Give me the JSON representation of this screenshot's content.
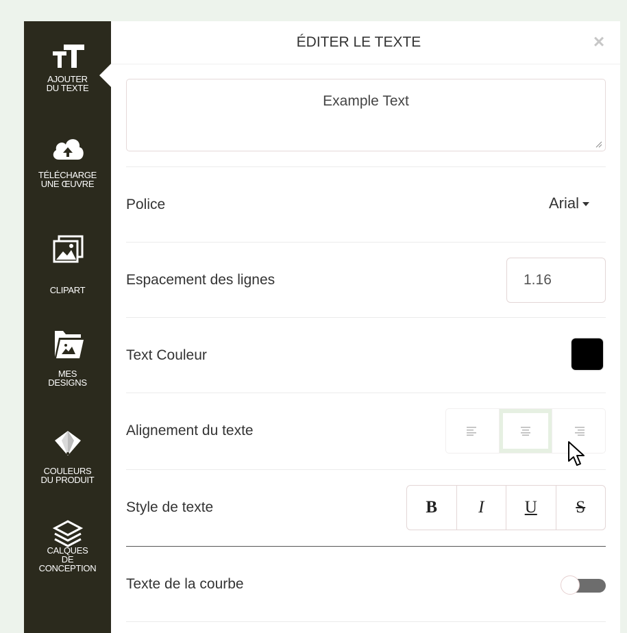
{
  "sidebar": {
    "items": [
      {
        "label": "AJOUTER\nDU TEXTE",
        "icon": "text-size-icon"
      },
      {
        "label": "TÉLÉCHARGE\nUNE ŒUVRE",
        "icon": "cloud-upload-icon"
      },
      {
        "label": "CLIPART",
        "icon": "image-stack-icon"
      },
      {
        "label": "MES\nDESIGNS",
        "icon": "folder-image-icon"
      },
      {
        "label": "COULEURS\nDU PRODUIT",
        "icon": "color-swatches-icon"
      },
      {
        "label": "CALQUES\nDE\nCONCEPTION",
        "icon": "layers-icon"
      }
    ]
  },
  "panel": {
    "title": "ÉDITER LE TEXTE",
    "close_icon": "×",
    "text_value": "Example Text",
    "font": {
      "label": "Police",
      "value": "Arial"
    },
    "line_spacing": {
      "label": "Espacement des lignes",
      "value": "1.16"
    },
    "text_color": {
      "label": "Text Couleur",
      "value": "#000000"
    },
    "alignment": {
      "label": "Alignement du texte",
      "options": [
        "left",
        "center",
        "right"
      ],
      "selected": "center"
    },
    "text_style": {
      "label": "Style de texte",
      "buttons": [
        "B",
        "I",
        "U",
        "S"
      ]
    },
    "curve": {
      "label": "Texte de la courbe",
      "enabled": false
    }
  },
  "colors": {
    "sidebar_bg": "#2b2a1d",
    "accent_active": "#e6f0e2",
    "page_bg": "#edf3ec"
  }
}
